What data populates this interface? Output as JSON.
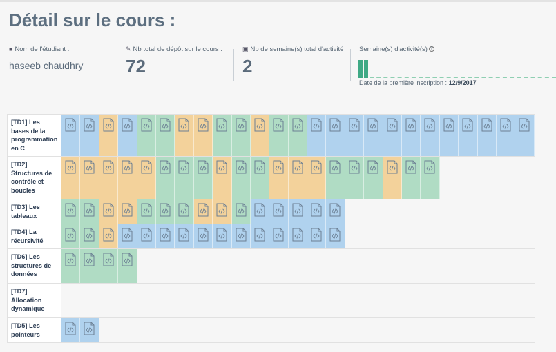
{
  "page": {
    "title": "Détail sur le cours :"
  },
  "stats": {
    "student": {
      "label": "Nom de l'étudiant :",
      "icon": "book-icon",
      "value": "haseeb chaudhry"
    },
    "deposits": {
      "label": "Nb total de dépôt sur le cours :",
      "icon": "pencil-icon",
      "value": "72"
    },
    "weeks": {
      "label": "Nb de semaine(s) total d'activité",
      "icon": "truck-icon",
      "value": "2"
    },
    "activity": {
      "label": "Semaine(s) d'activité(s)",
      "icon": "info-icon",
      "active_weeks": 2
    },
    "first_registration": {
      "label": "Date de la première inscription :",
      "value": "12/9/2017"
    }
  },
  "colors": {
    "blue": "#b0d2ee",
    "green": "#b0dcc4",
    "yellow": "#f3d29b",
    "activity_bar": "#3fa985"
  },
  "cell_icon": "code-file-icon",
  "rows": [
    {
      "label": "[TD1] Les bases de la programmation en C",
      "cells": [
        "b",
        "b",
        "y",
        "b",
        "g",
        "g",
        "y",
        "y",
        "g",
        "g",
        "y",
        "g",
        "g",
        "b",
        "b",
        "b",
        "b",
        "b",
        "b",
        "b",
        "b",
        "b",
        "b",
        "b",
        "b"
      ]
    },
    {
      "label": "[TD2] Structures de contrôle et boucles",
      "cells": [
        "y",
        "y",
        "y",
        "y",
        "y",
        "g",
        "g",
        "g",
        "y",
        "g",
        "g",
        "y",
        "y",
        "y",
        "g",
        "g",
        "g",
        "y",
        "g",
        "g"
      ]
    },
    {
      "label": "[TD3] Les tableaux",
      "cells": [
        "g",
        "g",
        "y",
        "y",
        "g",
        "g",
        "g",
        "y",
        "y",
        "g",
        "b",
        "b",
        "b",
        "b",
        "b"
      ]
    },
    {
      "label": "[TD4] La récursivité",
      "cells": [
        "g",
        "g",
        "y",
        "b",
        "b",
        "b",
        "b",
        "b",
        "b",
        "b",
        "b",
        "b",
        "b",
        "b",
        "b"
      ]
    },
    {
      "label": "[TD6] Les structures de données",
      "cells": [
        "g",
        "g",
        "g",
        "g"
      ]
    },
    {
      "label": "[TD7] Allocation dynamique",
      "cells": []
    },
    {
      "label": "[TD5] Les pointeurs",
      "cells": [
        "b",
        "b"
      ]
    }
  ]
}
